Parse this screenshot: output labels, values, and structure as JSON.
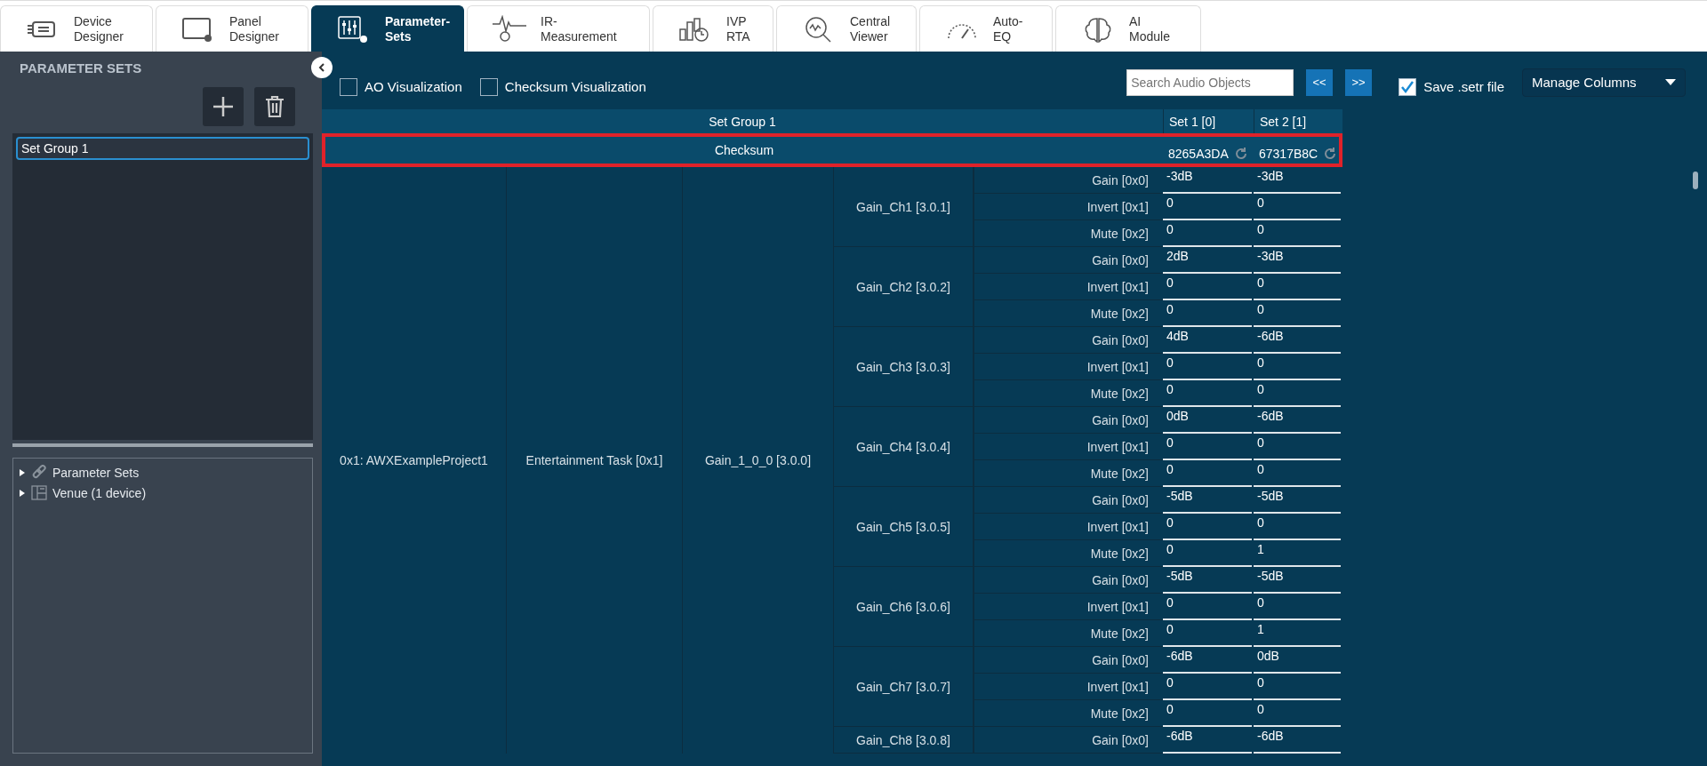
{
  "tabs": [
    {
      "lines": [
        "Device",
        "Designer"
      ],
      "selected": false
    },
    {
      "lines": [
        "Panel",
        "Designer"
      ],
      "selected": false
    },
    {
      "lines": [
        "Parameter-",
        "Sets"
      ],
      "selected": true
    },
    {
      "lines": [
        "IR-",
        "Measurement"
      ],
      "selected": false
    },
    {
      "lines": [
        "IVP",
        "RTA"
      ],
      "selected": false
    },
    {
      "lines": [
        "Central",
        "Viewer"
      ],
      "selected": false
    },
    {
      "lines": [
        "Auto-",
        "EQ"
      ],
      "selected": false
    },
    {
      "lines": [
        "AI",
        "Module"
      ],
      "selected": false
    }
  ],
  "sidebar": {
    "title": "PARAMETER SETS",
    "groups": [
      {
        "label": "Set Group 1",
        "selected": true
      }
    ],
    "tree": [
      {
        "label": "Parameter Sets",
        "expanded": false
      },
      {
        "label": "Venue (1 device)",
        "expanded": false
      }
    ]
  },
  "toolbar": {
    "checkboxes": [
      {
        "label": "AO Visualization",
        "checked": false
      },
      {
        "label": "Checksum Visualization",
        "checked": false
      }
    ],
    "search": {
      "placeholder": "Search Audio Objects"
    },
    "prev": "<<",
    "next": ">>",
    "save": {
      "label": "Save .setr file",
      "checked": true
    },
    "manage": "Manage Columns"
  },
  "table": {
    "group": "Set Group 1",
    "sets": [
      "Set 1 [0]",
      "Set 2 [1]"
    ],
    "checksum": {
      "label": "Checksum",
      "values": [
        "8265A3DA",
        "67317B8C"
      ],
      "highlighted": true
    },
    "project": "0x1: AWXExampleProject1",
    "task": "Entertainment Task [0x1]",
    "object": "Gain_1_0_0 [3.0.0]",
    "channels": [
      {
        "name": "Gain_Ch1 [3.0.1]",
        "params": [
          {
            "name": "Gain [0x0]",
            "values": [
              "-3dB",
              "-3dB"
            ]
          },
          {
            "name": "Invert [0x1]",
            "values": [
              "0",
              "0"
            ]
          },
          {
            "name": "Mute [0x2]",
            "values": [
              "0",
              "0"
            ]
          }
        ]
      },
      {
        "name": "Gain_Ch2 [3.0.2]",
        "params": [
          {
            "name": "Gain [0x0]",
            "values": [
              "2dB",
              "-3dB"
            ]
          },
          {
            "name": "Invert [0x1]",
            "values": [
              "0",
              "0"
            ]
          },
          {
            "name": "Mute [0x2]",
            "values": [
              "0",
              "0"
            ]
          }
        ]
      },
      {
        "name": "Gain_Ch3 [3.0.3]",
        "params": [
          {
            "name": "Gain [0x0]",
            "values": [
              "4dB",
              "-6dB"
            ]
          },
          {
            "name": "Invert [0x1]",
            "values": [
              "0",
              "0"
            ]
          },
          {
            "name": "Mute [0x2]",
            "values": [
              "0",
              "0"
            ]
          }
        ]
      },
      {
        "name": "Gain_Ch4 [3.0.4]",
        "params": [
          {
            "name": "Gain [0x0]",
            "values": [
              "0dB",
              "-6dB"
            ]
          },
          {
            "name": "Invert [0x1]",
            "values": [
              "0",
              "0"
            ]
          },
          {
            "name": "Mute [0x2]",
            "values": [
              "0",
              "0"
            ]
          }
        ]
      },
      {
        "name": "Gain_Ch5 [3.0.5]",
        "params": [
          {
            "name": "Gain [0x0]",
            "values": [
              "-5dB",
              "-5dB"
            ]
          },
          {
            "name": "Invert [0x1]",
            "values": [
              "0",
              "0"
            ]
          },
          {
            "name": "Mute [0x2]",
            "values": [
              "0",
              "1"
            ]
          }
        ]
      },
      {
        "name": "Gain_Ch6 [3.0.6]",
        "params": [
          {
            "name": "Gain [0x0]",
            "values": [
              "-5dB",
              "-5dB"
            ]
          },
          {
            "name": "Invert [0x1]",
            "values": [
              "0",
              "0"
            ]
          },
          {
            "name": "Mute [0x2]",
            "values": [
              "0",
              "1"
            ]
          }
        ]
      },
      {
        "name": "Gain_Ch7 [3.0.7]",
        "params": [
          {
            "name": "Gain [0x0]",
            "values": [
              "-6dB",
              "0dB"
            ]
          },
          {
            "name": "Invert [0x1]",
            "values": [
              "0",
              "0"
            ]
          },
          {
            "name": "Mute [0x2]",
            "values": [
              "0",
              "0"
            ]
          }
        ]
      },
      {
        "name": "Gain_Ch8 [3.0.8]",
        "params": [
          {
            "name": "Gain [0x0]",
            "values": [
              "-6dB",
              "-6dB"
            ]
          }
        ]
      }
    ]
  }
}
